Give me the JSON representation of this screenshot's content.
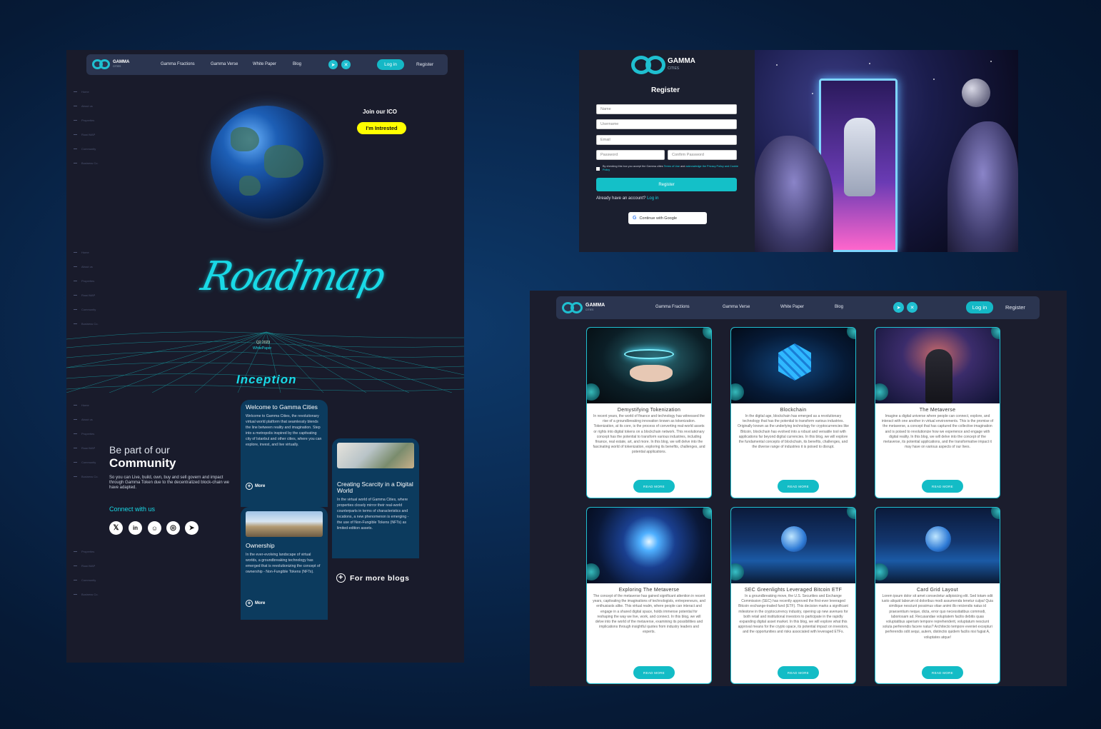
{
  "left": {
    "nav": {
      "brand": "GAMMA",
      "brand_sub": "CITIES",
      "links": [
        "Gamma Fractions",
        "Gamma Verse",
        "White Paper",
        "Blog"
      ],
      "login": "Log in",
      "register": "Register"
    },
    "side_menu_1": [
      "Home",
      "About us",
      "Properties",
      "Road MAP",
      "Community",
      "Business Co."
    ],
    "side_menu_2": [
      "Home",
      "About us",
      "Properties",
      "Road MAP",
      "Community",
      "Business Co."
    ],
    "side_menu_3": [
      "Home",
      "About us",
      "Properties",
      "Road MAP",
      "Community",
      "Business Co."
    ],
    "side_menu_4": [
      "Properties",
      "Road MAP",
      "Community",
      "Business Co."
    ],
    "ico_title": "Join our ICO",
    "ico_button": "I'm Intrested",
    "roadmap_title": "Roadmap",
    "q2": "Q2 2023",
    "q2_sub": "WhitePaper",
    "inception": "Inception",
    "community_pre": "Be part of our",
    "community_main": "Community",
    "community_desc": "So you can Live, build, own, buy and sell govern and impact through Gamma Token due to the decentralized block-chain we have adapted.",
    "connect": "Connect with us",
    "socials": [
      "x-icon",
      "linkedin-icon",
      "discord-icon",
      "instagram-icon",
      "telegram-icon"
    ],
    "blogs": [
      {
        "title": "Welcome to Gamma Cities",
        "body": "Welcome to Gamma Cities, the revolutionary virtual world platform that seamlessly blends the line between reality and imagination. Step into a metropolis inspired by the captivating city of Istanbul and other cities, where you can explore, invest, and live virtually.",
        "more": "More"
      },
      {
        "title": "Creating Scarcity in a Digital World",
        "body": "In the virtual world of Gamma Cities, where properties closely mirror their real-world counterparts in terms of characteristics and locations, a new phenomenon is emerging - the use of Non-Fungible Tokens (NFTs) as limited-edition assets."
      },
      {
        "title": "Ownership",
        "body": "In the ever-evolving landscape of virtual worlds, a groundbreaking technology has emerged that is revolutionizing the concept of ownership - Non-Fungible Tokens (NFTs).",
        "more": "More"
      }
    ],
    "more_blogs": "For more blogs"
  },
  "register": {
    "brand": "GAMMA",
    "brand_sub": "CITIES",
    "title": "Register",
    "name_ph": "Name",
    "username_ph": "Username",
    "email_ph": "Email",
    "password_ph": "Password",
    "confirm_ph": "Confirm Password",
    "terms_pre": "By checking this box you accept the Gamma cities",
    "terms_link1": "Terms of Use",
    "terms_mid": "and",
    "terms_link2": "acknowledge the Privacy Policy and Cookie Policy",
    "button": "Register",
    "have_account": "Already have an account?",
    "login_link": "Log in",
    "google": "Continue with Google"
  },
  "blog_grid": {
    "nav": {
      "brand": "GAMMA",
      "brand_sub": "CITIES",
      "links": [
        "Gamma Fractions",
        "Gamma Verse",
        "White Paper",
        "Blog"
      ],
      "login": "Log in",
      "register": "Register"
    },
    "read_more": "READ MORE",
    "cards": [
      {
        "title": "Demystifying Tokenization",
        "body": "In recent years, the world of finance and technology has witnessed the rise of a groundbreaking innovation known as tokenization. Tokenization, at its core, is the process of converting real-world assets or rights into digital tokens on a blockchain network. This revolutionary concept has the potential to transform various industries, including finance, real estate, art, and more. In this blog, we will delve into the fascinating world of tokenization, exploring its benefits, challenges, and potential applications."
      },
      {
        "title": "Blockchain",
        "body": "In the digital age, blockchain has emerged as a revolutionary technology that has the potential to transform various industries. Originally known as the underlying technology for cryptocurrencies like Bitcoin, blockchain has evolved into a robust and versatile tool with applications far beyond digital currencies. In this blog, we will explore the fundamental concepts of blockchain, its benefits, challenges, and the diverse range of industries it is poised to disrupt."
      },
      {
        "title": "The Metaverse",
        "body": "Imagine a digital universe where people can connect, explore, and interact with one another in virtual environments. This is the promise of the metaverse, a concept that has captured the collective imagination and is poised to revolutionize how we experience and engage with digital reality. In this blog, we will delve into the concept of the metaverse, its potential applications, and the transformative impact it may have on various aspects of our lives."
      },
      {
        "title": "Exploring The Metaverse",
        "body": "The concept of the metaverse has gained significant attention in recent years, captivating the imaginations of technologists, entrepreneurs, and enthusiasts alike. This virtual realm, where people can interact and engage in a shared digital space, holds immense potential for reshaping the way we live, work, and connect. In this blog, we will delve into the world of the metaverse, examining its possibilities and implications through insightful quotes from industry leaders and experts."
      },
      {
        "title": "SEC Greenlights Leveraged Bitcoin ETF",
        "body": "In a groundbreaking move, the U.S. Securities and Exchange Commission (SEC) has recently approved the first-ever leveraged Bitcoin exchange-traded fund (ETF). This decision marks a significant milestone in the cryptocurrency industry, opening up new avenues for both retail and institutional investors to participate in the rapidly expanding digital asset market. In this blog, we will explore what this approval means for the crypto space, its potential impact on investors, and the opportunities and risks associated with leveraged ETFs."
      },
      {
        "title": "Card Grid Layout",
        "body": "Lorem ipsum dolor sit amet consectetur adipisicing elit. Sed totam odit iusto aliquid laborum id doloribus modi assumenda tenetur culpa! Quia similique nesciunt possimus vitae animi illo reiciendis natus id praesentium neque, dicta, error quo necessitatibus commodi, laboriosam ad. Recusandae voluptatem facilis debitis quas voluptatibus aperiam tempore reprehenderit, voluptatum nesciunt soluta perferendis facere natus? Architecto tempore eveniet excepturi perferendis odit sequi, autem, distinctio quidem facilis nisi fugiat A, voluptates atque!"
      }
    ]
  }
}
